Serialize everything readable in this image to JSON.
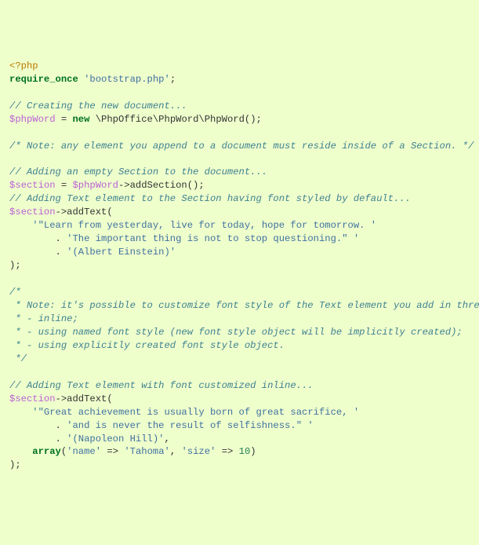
{
  "code": {
    "l01_open": "<?php",
    "l02_kw": "require_once",
    "l02_str": "'bootstrap.php'",
    "l02_semi": ";",
    "l04_cm": "// Creating the new document...",
    "l05_var": "$phpWord",
    "l05_eq": " = ",
    "l05_new": "new",
    "l05_cls": " \\PhpOffice\\PhpWord\\PhpWord();",
    "l07_cm": "/* Note: any element you append to a document must reside inside of a Section. */",
    "l09_cm": "// Adding an empty Section to the document...",
    "l10_var": "$section",
    "l10_eq": " = ",
    "l10_var2": "$phpWord",
    "l10_call": "->addSection();",
    "l11_cm": "// Adding Text element to the Section having font styled by default...",
    "l12_var": "$section",
    "l12_call": "->addText(",
    "l13_str": "'\"Learn from yesterday, live for today, hope for tomorrow. '",
    "l14_dot": "        . ",
    "l14_str": "'The important thing is not to stop questioning.\" '",
    "l15_dot": "        . ",
    "l15_str": "'(Albert Einstein)'",
    "l16_close": ");",
    "l18_cm1": "/*",
    "l18_cm2": " * Note: it's possible to customize font style of the Text element you add in three ways:",
    "l18_cm3": " * - inline;",
    "l18_cm4": " * - using named font style (new font style object will be implicitly created);",
    "l18_cm5": " * - using explicitly created font style object.",
    "l18_cm6": " */",
    "l25_cm": "// Adding Text element with font customized inline...",
    "l26_var": "$section",
    "l26_call": "->addText(",
    "l27_str": "'\"Great achievement is usually born of great sacrifice, '",
    "l28_dot": "        . ",
    "l28_str": "'and is never the result of selfishness.\" '",
    "l29_dot": "        . ",
    "l29_str": "'(Napoleon Hill)'",
    "l29_comma": ",",
    "l30_arr": "array",
    "l30_p1": "(",
    "l30_k1": "'name'",
    "l30_a1": " => ",
    "l30_v1": "'Tahoma'",
    "l30_c1": ", ",
    "l30_k2": "'size'",
    "l30_a2": " => ",
    "l30_v2": "10",
    "l30_p2": ")",
    "l31_close": ");"
  }
}
